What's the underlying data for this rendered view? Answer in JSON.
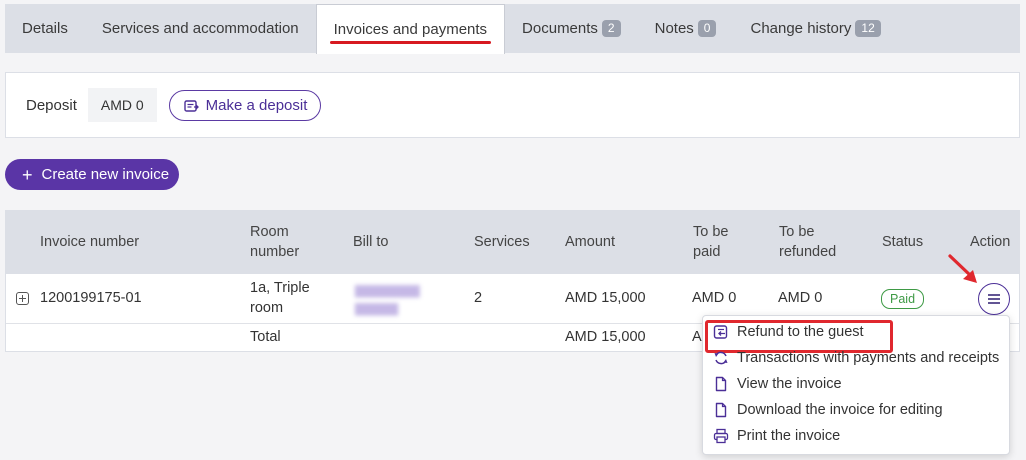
{
  "tabs": [
    {
      "label": "Details"
    },
    {
      "label": "Services and accommodation"
    },
    {
      "label": "Invoices and payments",
      "active": true
    },
    {
      "label": "Documents",
      "badge": "2"
    },
    {
      "label": "Notes",
      "badge": "0"
    },
    {
      "label": "Change history",
      "badge": "12"
    }
  ],
  "deposit": {
    "label": "Deposit",
    "value": "AMD 0",
    "button_label": "Make a deposit"
  },
  "create_invoice": {
    "label": "Create new invoice",
    "icon": "plus-icon"
  },
  "table": {
    "headers": {
      "invoice_number": "Invoice number",
      "room_number_1": "Room",
      "room_number_2": "number",
      "bill_to": "Bill to",
      "services": "Services",
      "amount": "Amount",
      "to_be_paid_1": "To be",
      "to_be_paid_2": "paid",
      "to_be_refunded_1": "To be",
      "to_be_refunded_2": "refunded",
      "status": "Status",
      "action": "Action"
    },
    "row": {
      "invoice_number": "1200199175-01",
      "room_1": "1a, Triple",
      "room_2": "room",
      "services": "2",
      "amount": "AMD 15,000",
      "to_be_paid": "AMD 0",
      "to_be_refunded": "AMD 0",
      "status": "Paid"
    },
    "total": {
      "label": "Total",
      "amount": "AMD 15,000",
      "to_be_paid_partial": "A"
    }
  },
  "action_menu": {
    "items": [
      {
        "label": "Refund to the guest",
        "icon": "refund-icon"
      },
      {
        "label": "Transactions with payments and receipts",
        "icon": "refresh-icon"
      },
      {
        "label": "View the invoice",
        "icon": "document-icon"
      },
      {
        "label": "Download the invoice for editing",
        "icon": "document-icon"
      },
      {
        "label": "Print the invoice",
        "icon": "printer-icon"
      }
    ]
  },
  "colors": {
    "primary": "#5a35a6",
    "highlight": "#e0282e",
    "paid": "#3e9a45"
  }
}
